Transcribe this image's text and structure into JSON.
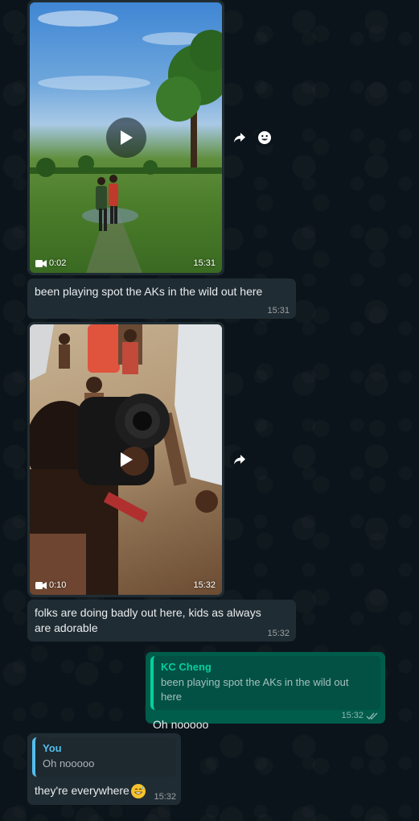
{
  "messages": [
    {
      "type": "video",
      "duration": "0:02",
      "time": "15:31"
    },
    {
      "type": "text",
      "text": "been playing spot the AKs in the wild out here",
      "time": "15:31"
    },
    {
      "type": "video",
      "duration": "0:10",
      "time": "15:32"
    },
    {
      "type": "text",
      "text": "folks are doing badly out here, kids as always are adorable",
      "time": "15:32"
    },
    {
      "type": "reply_out",
      "quote_author": "KC Cheng",
      "quote_text": "been playing spot the AKs in the wild out here",
      "text": "Oh nooooo",
      "time": "15:32",
      "status": "read"
    },
    {
      "type": "reply_in",
      "quote_author": "You",
      "quote_text": "Oh nooooo",
      "text": "they're everywhere",
      "time": "15:32"
    }
  ],
  "icons": {
    "forward": "forward-icon",
    "react": "emoji-icon",
    "play": "play-icon",
    "video": "video-camera-icon",
    "read_receipt": "double-check-icon"
  },
  "colors": {
    "background": "#0b141a",
    "incoming_bubble": "#202c33",
    "outgoing_bubble": "#005c4b",
    "quote_green_author": "#06cf9c",
    "quote_blue_author": "#53bdeb"
  }
}
